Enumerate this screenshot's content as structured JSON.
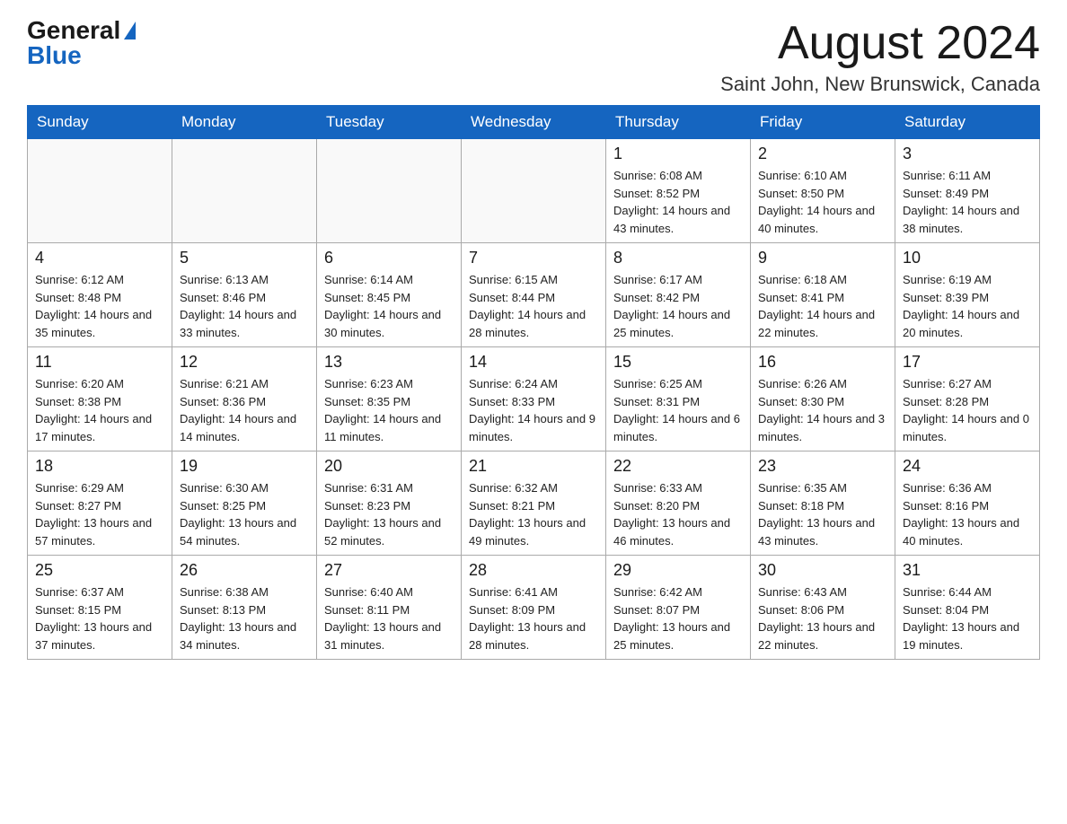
{
  "logo": {
    "general": "General",
    "blue": "Blue"
  },
  "header": {
    "month": "August 2024",
    "location": "Saint John, New Brunswick, Canada"
  },
  "weekdays": [
    "Sunday",
    "Monday",
    "Tuesday",
    "Wednesday",
    "Thursday",
    "Friday",
    "Saturday"
  ],
  "weeks": [
    [
      {
        "day": "",
        "info": ""
      },
      {
        "day": "",
        "info": ""
      },
      {
        "day": "",
        "info": ""
      },
      {
        "day": "",
        "info": ""
      },
      {
        "day": "1",
        "info": "Sunrise: 6:08 AM\nSunset: 8:52 PM\nDaylight: 14 hours and 43 minutes."
      },
      {
        "day": "2",
        "info": "Sunrise: 6:10 AM\nSunset: 8:50 PM\nDaylight: 14 hours and 40 minutes."
      },
      {
        "day": "3",
        "info": "Sunrise: 6:11 AM\nSunset: 8:49 PM\nDaylight: 14 hours and 38 minutes."
      }
    ],
    [
      {
        "day": "4",
        "info": "Sunrise: 6:12 AM\nSunset: 8:48 PM\nDaylight: 14 hours and 35 minutes."
      },
      {
        "day": "5",
        "info": "Sunrise: 6:13 AM\nSunset: 8:46 PM\nDaylight: 14 hours and 33 minutes."
      },
      {
        "day": "6",
        "info": "Sunrise: 6:14 AM\nSunset: 8:45 PM\nDaylight: 14 hours and 30 minutes."
      },
      {
        "day": "7",
        "info": "Sunrise: 6:15 AM\nSunset: 8:44 PM\nDaylight: 14 hours and 28 minutes."
      },
      {
        "day": "8",
        "info": "Sunrise: 6:17 AM\nSunset: 8:42 PM\nDaylight: 14 hours and 25 minutes."
      },
      {
        "day": "9",
        "info": "Sunrise: 6:18 AM\nSunset: 8:41 PM\nDaylight: 14 hours and 22 minutes."
      },
      {
        "day": "10",
        "info": "Sunrise: 6:19 AM\nSunset: 8:39 PM\nDaylight: 14 hours and 20 minutes."
      }
    ],
    [
      {
        "day": "11",
        "info": "Sunrise: 6:20 AM\nSunset: 8:38 PM\nDaylight: 14 hours and 17 minutes."
      },
      {
        "day": "12",
        "info": "Sunrise: 6:21 AM\nSunset: 8:36 PM\nDaylight: 14 hours and 14 minutes."
      },
      {
        "day": "13",
        "info": "Sunrise: 6:23 AM\nSunset: 8:35 PM\nDaylight: 14 hours and 11 minutes."
      },
      {
        "day": "14",
        "info": "Sunrise: 6:24 AM\nSunset: 8:33 PM\nDaylight: 14 hours and 9 minutes."
      },
      {
        "day": "15",
        "info": "Sunrise: 6:25 AM\nSunset: 8:31 PM\nDaylight: 14 hours and 6 minutes."
      },
      {
        "day": "16",
        "info": "Sunrise: 6:26 AM\nSunset: 8:30 PM\nDaylight: 14 hours and 3 minutes."
      },
      {
        "day": "17",
        "info": "Sunrise: 6:27 AM\nSunset: 8:28 PM\nDaylight: 14 hours and 0 minutes."
      }
    ],
    [
      {
        "day": "18",
        "info": "Sunrise: 6:29 AM\nSunset: 8:27 PM\nDaylight: 13 hours and 57 minutes."
      },
      {
        "day": "19",
        "info": "Sunrise: 6:30 AM\nSunset: 8:25 PM\nDaylight: 13 hours and 54 minutes."
      },
      {
        "day": "20",
        "info": "Sunrise: 6:31 AM\nSunset: 8:23 PM\nDaylight: 13 hours and 52 minutes."
      },
      {
        "day": "21",
        "info": "Sunrise: 6:32 AM\nSunset: 8:21 PM\nDaylight: 13 hours and 49 minutes."
      },
      {
        "day": "22",
        "info": "Sunrise: 6:33 AM\nSunset: 8:20 PM\nDaylight: 13 hours and 46 minutes."
      },
      {
        "day": "23",
        "info": "Sunrise: 6:35 AM\nSunset: 8:18 PM\nDaylight: 13 hours and 43 minutes."
      },
      {
        "day": "24",
        "info": "Sunrise: 6:36 AM\nSunset: 8:16 PM\nDaylight: 13 hours and 40 minutes."
      }
    ],
    [
      {
        "day": "25",
        "info": "Sunrise: 6:37 AM\nSunset: 8:15 PM\nDaylight: 13 hours and 37 minutes."
      },
      {
        "day": "26",
        "info": "Sunrise: 6:38 AM\nSunset: 8:13 PM\nDaylight: 13 hours and 34 minutes."
      },
      {
        "day": "27",
        "info": "Sunrise: 6:40 AM\nSunset: 8:11 PM\nDaylight: 13 hours and 31 minutes."
      },
      {
        "day": "28",
        "info": "Sunrise: 6:41 AM\nSunset: 8:09 PM\nDaylight: 13 hours and 28 minutes."
      },
      {
        "day": "29",
        "info": "Sunrise: 6:42 AM\nSunset: 8:07 PM\nDaylight: 13 hours and 25 minutes."
      },
      {
        "day": "30",
        "info": "Sunrise: 6:43 AM\nSunset: 8:06 PM\nDaylight: 13 hours and 22 minutes."
      },
      {
        "day": "31",
        "info": "Sunrise: 6:44 AM\nSunset: 8:04 PM\nDaylight: 13 hours and 19 minutes."
      }
    ]
  ]
}
